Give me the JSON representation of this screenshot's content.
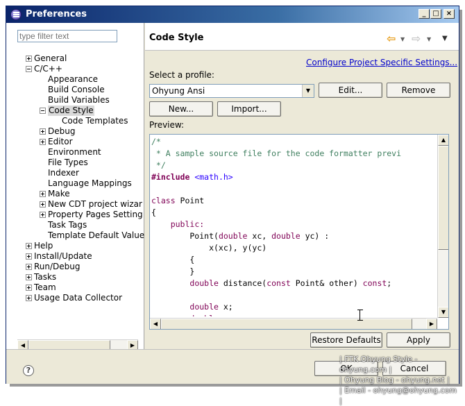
{
  "window": {
    "title": "Preferences"
  },
  "sidebar": {
    "filter_placeholder": "type filter text",
    "tree": [
      {
        "label": "General",
        "depth": 0,
        "expander": "plus"
      },
      {
        "label": "C/C++",
        "depth": 0,
        "expander": "minus"
      },
      {
        "label": "Appearance",
        "depth": 1,
        "expander": "none"
      },
      {
        "label": "Build Console",
        "depth": 1,
        "expander": "none"
      },
      {
        "label": "Build Variables",
        "depth": 1,
        "expander": "none"
      },
      {
        "label": "Code Style",
        "depth": 1,
        "expander": "minus",
        "selected": true
      },
      {
        "label": "Code Templates",
        "depth": 2,
        "expander": "none"
      },
      {
        "label": "Debug",
        "depth": 1,
        "expander": "plus"
      },
      {
        "label": "Editor",
        "depth": 1,
        "expander": "plus"
      },
      {
        "label": "Environment",
        "depth": 1,
        "expander": "none"
      },
      {
        "label": "File Types",
        "depth": 1,
        "expander": "none"
      },
      {
        "label": "Indexer",
        "depth": 1,
        "expander": "none"
      },
      {
        "label": "Language Mappings",
        "depth": 1,
        "expander": "none"
      },
      {
        "label": "Make",
        "depth": 1,
        "expander": "plus"
      },
      {
        "label": "New CDT project wizar",
        "depth": 1,
        "expander": "plus"
      },
      {
        "label": "Property Pages Setting",
        "depth": 1,
        "expander": "plus"
      },
      {
        "label": "Task Tags",
        "depth": 1,
        "expander": "none"
      },
      {
        "label": "Template Default Value",
        "depth": 1,
        "expander": "none"
      },
      {
        "label": "Help",
        "depth": 0,
        "expander": "plus"
      },
      {
        "label": "Install/Update",
        "depth": 0,
        "expander": "plus"
      },
      {
        "label": "Run/Debug",
        "depth": 0,
        "expander": "plus"
      },
      {
        "label": "Tasks",
        "depth": 0,
        "expander": "plus"
      },
      {
        "label": "Team",
        "depth": 0,
        "expander": "plus"
      },
      {
        "label": "Usage Data Collector",
        "depth": 0,
        "expander": "plus"
      }
    ]
  },
  "main": {
    "title": "Code Style",
    "configure_link": "Configure Project Specific Settings...",
    "profile_label": "Select a profile:",
    "profile_value": "Ohyung Ansi",
    "edit_button": "Edit...",
    "remove_button": "Remove",
    "new_button": "New...",
    "import_button": "Import...",
    "preview_label": "Preview:",
    "restore_button": "Restore Defaults",
    "apply_button": "Apply"
  },
  "preview_code": [
    [
      {
        "t": "/*",
        "c": "c-comment"
      }
    ],
    [
      {
        "t": " * A sample source file for the code formatter previ",
        "c": "c-comment"
      }
    ],
    [
      {
        "t": " */",
        "c": "c-comment"
      }
    ],
    [
      {
        "t": "#include",
        "c": "c-pre"
      },
      {
        "t": " ",
        "c": ""
      },
      {
        "t": "<math.h>",
        "c": "c-inc"
      }
    ],
    [
      {
        "t": "",
        "c": ""
      }
    ],
    [
      {
        "t": "class",
        "c": "c-kw"
      },
      {
        "t": " Point",
        "c": ""
      }
    ],
    [
      {
        "t": "{",
        "c": ""
      }
    ],
    [
      {
        "t": "    ",
        "c": ""
      },
      {
        "t": "public:",
        "c": "c-kw"
      }
    ],
    [
      {
        "t": "        Point(",
        "c": ""
      },
      {
        "t": "double",
        "c": "c-kw"
      },
      {
        "t": " xc, ",
        "c": ""
      },
      {
        "t": "double",
        "c": "c-kw"
      },
      {
        "t": " yc) :",
        "c": ""
      }
    ],
    [
      {
        "t": "            x(xc), y(yc)",
        "c": ""
      }
    ],
    [
      {
        "t": "        {",
        "c": ""
      }
    ],
    [
      {
        "t": "        }",
        "c": ""
      }
    ],
    [
      {
        "t": "        ",
        "c": ""
      },
      {
        "t": "double",
        "c": "c-kw"
      },
      {
        "t": " distance(",
        "c": ""
      },
      {
        "t": "const",
        "c": "c-kw"
      },
      {
        "t": " Point& other) ",
        "c": ""
      },
      {
        "t": "const",
        "c": "c-kw"
      },
      {
        "t": ";",
        "c": ""
      }
    ],
    [
      {
        "t": "",
        "c": ""
      }
    ],
    [
      {
        "t": "        ",
        "c": ""
      },
      {
        "t": "double",
        "c": "c-kw"
      },
      {
        "t": " x;",
        "c": ""
      }
    ],
    [
      {
        "t": "        ",
        "c": ""
      },
      {
        "t": "double",
        "c": "c-kw"
      },
      {
        "t": " y;",
        "c": ""
      }
    ]
  ],
  "footer": {
    "ok_button": "OK",
    "cancel_button": "Cancel",
    "watermark": [
      "| FTK Ohyung Style - ohyung.com |",
      "| Ohyung Blog - ohyung.net |",
      "| Email - ohyung@ohyung.com |"
    ]
  }
}
